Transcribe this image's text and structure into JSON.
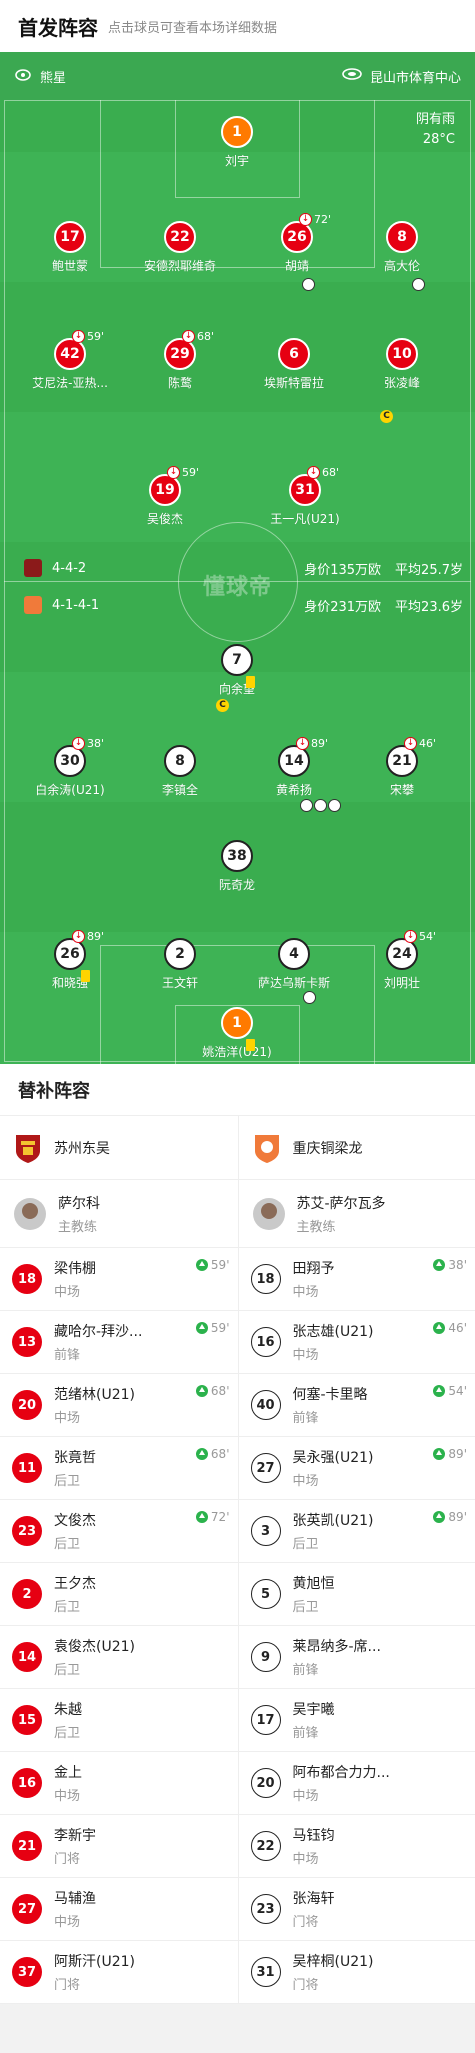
{
  "header": {
    "title": "首发阵容",
    "subtitle": "点击球员可查看本场详细数据"
  },
  "pitch": {
    "home_label": "熊星",
    "venue": "昆山市体育中心",
    "weather": "阴有雨",
    "temperature": "28°C",
    "brand": "懂球帝",
    "home_info": {
      "formation": "4-4-2",
      "value": "身价135万欧",
      "age": "平均25.7岁"
    },
    "away_info": {
      "formation": "4-1-4-1",
      "value": "身价231万欧",
      "age": "平均23.6岁"
    },
    "colors": {
      "pitch": "#3aad4f",
      "home": "#e60012",
      "away": "#ffffff",
      "goalkeeper": "#ff7a00"
    }
  },
  "home_players": [
    {
      "num": "1",
      "name": "刘宇",
      "color": "orange"
    },
    {
      "num": "17",
      "name": "鲍世蒙",
      "color": "red"
    },
    {
      "num": "22",
      "name": "安德烈耶维奇",
      "color": "red"
    },
    {
      "num": "26",
      "name": "胡靖",
      "color": "red",
      "sub": "72'"
    },
    {
      "num": "8",
      "name": "高大伦",
      "color": "red"
    },
    {
      "num": "42",
      "name": "艾尼法-亚热...",
      "color": "red",
      "sub": "59'"
    },
    {
      "num": "29",
      "name": "陈鹜",
      "color": "red",
      "sub": "68'"
    },
    {
      "num": "6",
      "name": "埃斯特雷拉",
      "color": "red"
    },
    {
      "num": "10",
      "name": "张凌峰",
      "color": "red"
    },
    {
      "num": "19",
      "name": "吴俊杰",
      "color": "red",
      "sub": "59'"
    },
    {
      "num": "31",
      "name": "王一凡(U21)",
      "color": "red",
      "sub": "68'"
    }
  ],
  "away_players": [
    {
      "num": "7",
      "name": "向余望",
      "color": "white"
    },
    {
      "num": "30",
      "name": "白余涛(U21)",
      "color": "white",
      "sub": "38'"
    },
    {
      "num": "8",
      "name": "李镇全",
      "color": "white"
    },
    {
      "num": "14",
      "name": "黄希扬",
      "color": "white",
      "sub": "89'"
    },
    {
      "num": "21",
      "name": "宋攀",
      "color": "white",
      "sub": "46'"
    },
    {
      "num": "38",
      "name": "阮奇龙",
      "color": "white"
    },
    {
      "num": "26",
      "name": "和晓强",
      "color": "white",
      "sub": "89'"
    },
    {
      "num": "2",
      "name": "王文轩",
      "color": "white"
    },
    {
      "num": "4",
      "name": "萨达乌斯卡斯",
      "color": "white"
    },
    {
      "num": "24",
      "name": "刘明壮",
      "color": "white",
      "sub": "54'"
    },
    {
      "num": "1",
      "name": "姚浩洋(U21)",
      "color": "orange"
    }
  ],
  "subs": {
    "title": "替补阵容",
    "home": {
      "team": "苏州东吴",
      "coach": {
        "name": "萨尔科",
        "role": "主教练"
      },
      "players": [
        {
          "num": "18",
          "name": "梁伟棚",
          "pos": "中场",
          "time": "59'"
        },
        {
          "num": "13",
          "name": "藏哈尔-拜沙...",
          "pos": "前锋",
          "time": "59'"
        },
        {
          "num": "20",
          "name": "范绪林(U21)",
          "pos": "中场",
          "time": "68'"
        },
        {
          "num": "11",
          "name": "张竟哲",
          "pos": "后卫",
          "time": "68'"
        },
        {
          "num": "23",
          "name": "文俊杰",
          "pos": "后卫",
          "time": "72'"
        },
        {
          "num": "2",
          "name": "王夕杰",
          "pos": "后卫",
          "time": ""
        },
        {
          "num": "14",
          "name": "袁俊杰(U21)",
          "pos": "后卫",
          "time": ""
        },
        {
          "num": "15",
          "name": "朱越",
          "pos": "后卫",
          "time": ""
        },
        {
          "num": "16",
          "name": "金上",
          "pos": "中场",
          "time": ""
        },
        {
          "num": "21",
          "name": "李新宇",
          "pos": "门将",
          "time": ""
        },
        {
          "num": "27",
          "name": "马辅渔",
          "pos": "中场",
          "time": ""
        },
        {
          "num": "37",
          "name": "阿斯汗(U21)",
          "pos": "门将",
          "time": ""
        }
      ]
    },
    "away": {
      "team": "重庆铜梁龙",
      "coach": {
        "name": "苏艾-萨尔瓦多",
        "role": "主教练"
      },
      "players": [
        {
          "num": "18",
          "name": "田翔予",
          "pos": "中场",
          "time": "38'"
        },
        {
          "num": "16",
          "name": "张志雄(U21)",
          "pos": "中场",
          "time": "46'"
        },
        {
          "num": "40",
          "name": "何塞-卡里略",
          "pos": "前锋",
          "time": "54'"
        },
        {
          "num": "27",
          "name": "吴永强(U21)",
          "pos": "中场",
          "time": "89'"
        },
        {
          "num": "3",
          "name": "张英凯(U21)",
          "pos": "后卫",
          "time": "89'"
        },
        {
          "num": "5",
          "name": "黄旭恒",
          "pos": "后卫",
          "time": ""
        },
        {
          "num": "9",
          "name": "莱昂纳多-席...",
          "pos": "前锋",
          "time": ""
        },
        {
          "num": "17",
          "name": "吴宇曦",
          "pos": "前锋",
          "time": ""
        },
        {
          "num": "20",
          "name": "阿布都合力力...",
          "pos": "中场",
          "time": ""
        },
        {
          "num": "22",
          "name": "马钰钧",
          "pos": "中场",
          "time": ""
        },
        {
          "num": "23",
          "name": "张海轩",
          "pos": "门将",
          "time": ""
        },
        {
          "num": "31",
          "name": "吴梓桐(U21)",
          "pos": "门将",
          "time": ""
        }
      ]
    }
  }
}
